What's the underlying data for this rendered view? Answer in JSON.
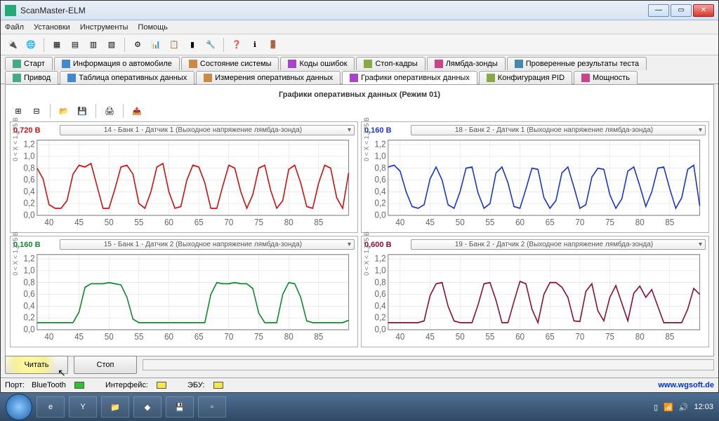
{
  "window": {
    "title": "ScanMaster-ELM"
  },
  "menu": [
    "Файл",
    "Установки",
    "Инструменты",
    "Помощь"
  ],
  "tabs_row1": [
    {
      "label": "Старт"
    },
    {
      "label": "Информация о автомобиле"
    },
    {
      "label": "Состояние системы"
    },
    {
      "label": "Коды ошибок"
    },
    {
      "label": "Стоп-кадры"
    },
    {
      "label": "Лямбда-зонды"
    },
    {
      "label": "Проверенные результаты теста"
    }
  ],
  "tabs_row2": [
    {
      "label": "Привод"
    },
    {
      "label": "Таблица оперативных данных"
    },
    {
      "label": "Измерения оперативных данных"
    },
    {
      "label": "Графики оперативных данных",
      "active": true
    },
    {
      "label": "Конфигурация PID"
    },
    {
      "label": "Мощность"
    }
  ],
  "panel_title": "Графики оперативных данных (Режим 01)",
  "ylabel": "0  < X <  1,275  В",
  "y_ticks": [
    "0",
    "0,2",
    "0,4",
    "0,6",
    "0,8",
    "1",
    "1,2"
  ],
  "x_ticks": [
    "40",
    "45",
    "50",
    "55",
    "60",
    "65",
    "70",
    "75",
    "80",
    "85"
  ],
  "charts": [
    {
      "value": "0,720 В",
      "color": "#d01010",
      "select": "14 - Банк 1 - Датчик 1 (Выходное напряжение лямбда-зонда)"
    },
    {
      "value": "0,160 В",
      "color": "#1a36d0",
      "select": "18 - Банк 2 - Датчик 1 (Выходное напряжение лямбда-зонда)"
    },
    {
      "value": "0,160 В",
      "color": "#108a30",
      "select": "15 - Банк 1 - Датчик 2 (Выходное напряжение лямбда-зонда)"
    },
    {
      "value": "0,600 В",
      "color": "#8a1030",
      "select": "19 - Банк 2 - Датчик 2 (Выходное напряжение лямбда-зонда)"
    }
  ],
  "buttons": {
    "read": "Читать",
    "stop": "Стоп"
  },
  "status": {
    "port_label": "Порт:",
    "port_value": "BlueTooth",
    "iface_label": "Интерфейс:",
    "ecu_label": "ЭБУ:",
    "link": "www.wgsoft.de"
  },
  "clock": "12:03",
  "chart_data": [
    {
      "type": "line",
      "title": "14 - Банк 1 - Датчик 1",
      "xlabel": "",
      "ylabel": "0 < X < 1,275 В",
      "ylim": [
        0,
        1.275
      ],
      "xlim": [
        38,
        90
      ],
      "x": [
        38,
        39,
        40,
        41,
        42,
        43,
        44,
        45,
        46,
        47,
        48,
        49,
        50,
        51,
        52,
        53,
        54,
        55,
        56,
        57,
        58,
        59,
        60,
        61,
        62,
        63,
        64,
        65,
        66,
        67,
        68,
        69,
        70,
        71,
        72,
        73,
        74,
        75,
        76,
        77,
        78,
        79,
        80,
        81,
        82,
        83,
        84,
        85,
        86,
        87,
        88,
        89,
        90
      ],
      "values": [
        0.8,
        0.62,
        0.18,
        0.12,
        0.12,
        0.25,
        0.7,
        0.85,
        0.82,
        0.88,
        0.5,
        0.12,
        0.12,
        0.45,
        0.82,
        0.85,
        0.7,
        0.2,
        0.12,
        0.4,
        0.82,
        0.88,
        0.4,
        0.12,
        0.15,
        0.6,
        0.85,
        0.82,
        0.55,
        0.12,
        0.12,
        0.5,
        0.85,
        0.8,
        0.4,
        0.12,
        0.35,
        0.8,
        0.85,
        0.42,
        0.12,
        0.25,
        0.78,
        0.85,
        0.55,
        0.15,
        0.12,
        0.55,
        0.85,
        0.8,
        0.3,
        0.12,
        0.72
      ]
    },
    {
      "type": "line",
      "title": "18 - Банк 2 - Датчик 1",
      "xlabel": "",
      "ylabel": "0 < X < 1,275 В",
      "ylim": [
        0,
        1.275
      ],
      "xlim": [
        38,
        90
      ],
      "x": [
        38,
        39,
        40,
        41,
        42,
        43,
        44,
        45,
        46,
        47,
        48,
        49,
        50,
        51,
        52,
        53,
        54,
        55,
        56,
        57,
        58,
        59,
        60,
        61,
        62,
        63,
        64,
        65,
        66,
        67,
        68,
        69,
        70,
        71,
        72,
        73,
        74,
        75,
        76,
        77,
        78,
        79,
        80,
        81,
        82,
        83,
        84,
        85,
        86,
        87,
        88,
        89,
        90
      ],
      "values": [
        0.82,
        0.85,
        0.75,
        0.4,
        0.15,
        0.12,
        0.18,
        0.62,
        0.82,
        0.6,
        0.18,
        0.12,
        0.4,
        0.8,
        0.82,
        0.38,
        0.12,
        0.2,
        0.72,
        0.82,
        0.55,
        0.15,
        0.12,
        0.45,
        0.8,
        0.78,
        0.3,
        0.12,
        0.25,
        0.72,
        0.82,
        0.48,
        0.12,
        0.18,
        0.65,
        0.8,
        0.78,
        0.35,
        0.12,
        0.28,
        0.75,
        0.82,
        0.5,
        0.15,
        0.4,
        0.8,
        0.82,
        0.45,
        0.12,
        0.3,
        0.78,
        0.85,
        0.16
      ]
    },
    {
      "type": "line",
      "title": "15 - Банк 1 - Датчик 2",
      "xlabel": "",
      "ylabel": "0 < X < 1,275 В",
      "ylim": [
        0,
        1.275
      ],
      "xlim": [
        38,
        90
      ],
      "x": [
        38,
        39,
        40,
        41,
        42,
        43,
        44,
        45,
        46,
        47,
        48,
        49,
        50,
        51,
        52,
        53,
        54,
        55,
        56,
        57,
        58,
        59,
        60,
        61,
        62,
        63,
        64,
        65,
        66,
        67,
        68,
        69,
        70,
        71,
        72,
        73,
        74,
        75,
        76,
        77,
        78,
        79,
        80,
        81,
        82,
        83,
        84,
        85,
        86,
        87,
        88,
        89,
        90
      ],
      "values": [
        0.12,
        0.12,
        0.12,
        0.12,
        0.12,
        0.12,
        0.12,
        0.3,
        0.72,
        0.78,
        0.78,
        0.78,
        0.8,
        0.78,
        0.76,
        0.55,
        0.18,
        0.12,
        0.12,
        0.12,
        0.12,
        0.12,
        0.12,
        0.12,
        0.12,
        0.12,
        0.12,
        0.12,
        0.12,
        0.6,
        0.8,
        0.78,
        0.78,
        0.8,
        0.78,
        0.78,
        0.7,
        0.28,
        0.12,
        0.12,
        0.12,
        0.6,
        0.8,
        0.78,
        0.55,
        0.15,
        0.12,
        0.12,
        0.12,
        0.12,
        0.12,
        0.12,
        0.16
      ]
    },
    {
      "type": "line",
      "title": "19 - Банк 2 - Датчик 2",
      "xlabel": "",
      "ylabel": "0 < X < 1,275 В",
      "ylim": [
        0,
        1.275
      ],
      "xlim": [
        38,
        90
      ],
      "x": [
        38,
        39,
        40,
        41,
        42,
        43,
        44,
        45,
        46,
        47,
        48,
        49,
        50,
        51,
        52,
        53,
        54,
        55,
        56,
        57,
        58,
        59,
        60,
        61,
        62,
        63,
        64,
        65,
        66,
        67,
        68,
        69,
        70,
        71,
        72,
        73,
        74,
        75,
        76,
        77,
        78,
        79,
        80,
        81,
        82,
        83,
        84,
        85,
        86,
        87,
        88,
        89,
        90
      ],
      "values": [
        0.12,
        0.12,
        0.12,
        0.12,
        0.12,
        0.12,
        0.15,
        0.58,
        0.78,
        0.8,
        0.4,
        0.15,
        0.12,
        0.12,
        0.12,
        0.42,
        0.78,
        0.8,
        0.5,
        0.12,
        0.12,
        0.48,
        0.82,
        0.78,
        0.35,
        0.12,
        0.6,
        0.8,
        0.8,
        0.72,
        0.55,
        0.15,
        0.14,
        0.65,
        0.78,
        0.32,
        0.15,
        0.55,
        0.75,
        0.45,
        0.15,
        0.62,
        0.74,
        0.55,
        0.68,
        0.4,
        0.12,
        0.12,
        0.12,
        0.12,
        0.35,
        0.7,
        0.6
      ]
    }
  ]
}
